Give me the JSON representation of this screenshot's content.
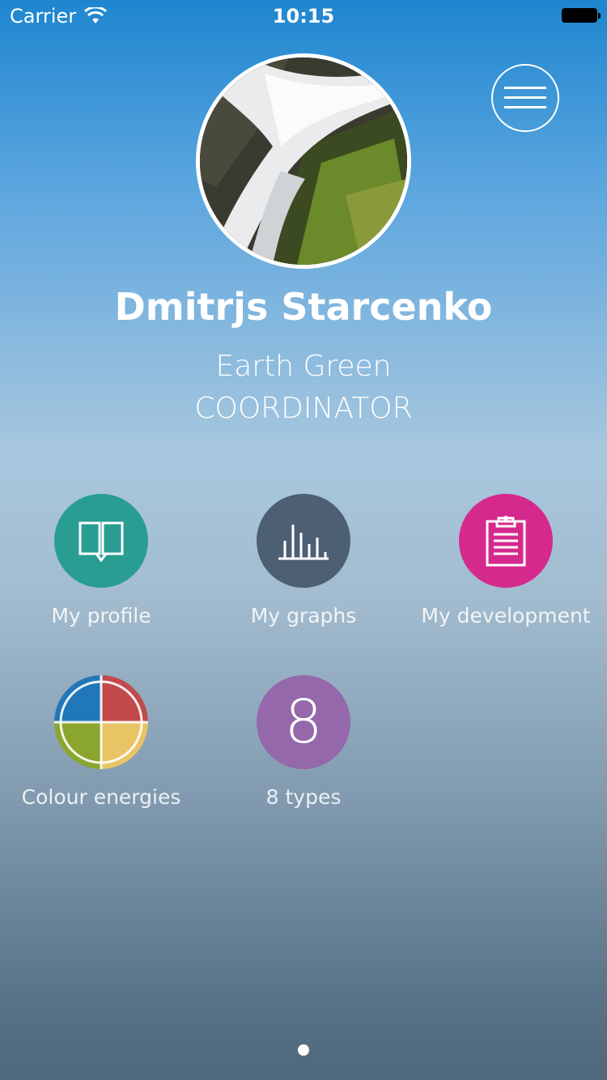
{
  "status_bar": {
    "carrier": "Carrier",
    "time": "10:15"
  },
  "profile": {
    "name": "Dmitrjs Starcenko",
    "color_energy": "Earth Green",
    "type": "COORDINATOR"
  },
  "tiles": [
    {
      "label": "My profile",
      "icon": "book-icon",
      "color": "#2a9d93"
    },
    {
      "label": "My graphs",
      "icon": "bar-chart-icon",
      "color": "#4d6073"
    },
    {
      "label": "My development",
      "icon": "clipboard-icon",
      "color": "#d6298e"
    },
    {
      "label": "Colour energies",
      "icon": "colour-wheel-icon",
      "colors": [
        "#2178b8",
        "#c24a4a",
        "#8aa62e",
        "#e8c464"
      ]
    },
    {
      "label": "8 types",
      "icon": "eight-icon",
      "glyph": "8",
      "color": "#9468aa"
    }
  ],
  "page_indicator": {
    "pages": 1,
    "current": 1
  }
}
